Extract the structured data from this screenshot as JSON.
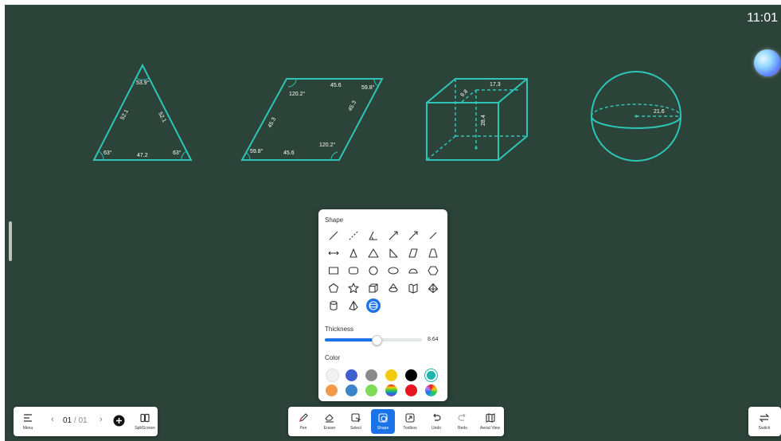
{
  "status": {
    "time": "11:01"
  },
  "figures": {
    "triangle": {
      "angle_top": "53.9°",
      "side_left": "52.1",
      "side_right": "52.1",
      "angle_left": "63°",
      "base": "47.2",
      "angle_right": "63°"
    },
    "parallelogram": {
      "angle_top_left": "120.2°",
      "top_side": "45.6",
      "angle_top_right": "59.8°",
      "left_side": "45.3",
      "right_side": "45.3",
      "angle_bottom_right": "120.2°",
      "angle_bottom_left": "59.8°",
      "bottom_side": "45.6"
    },
    "cube": {
      "depth": "9.8",
      "width": "17.3",
      "height": "28.4"
    },
    "sphere": {
      "radius": "21.6"
    }
  },
  "shape_panel": {
    "title": "Shape",
    "shapes": [
      "line-icon",
      "dashed-line-icon",
      "angle-icon",
      "arrow-icon",
      "double-arrow-icon",
      "pen-line-icon",
      "double-headed-arrow-icon",
      "isosceles-triangle-icon",
      "triangle-icon",
      "right-triangle-icon",
      "parallelogram-icon",
      "trapezoid-icon",
      "rectangle-icon",
      "rounded-rectangle-icon",
      "circle-icon",
      "ellipse-icon",
      "semicircle-icon",
      "hexagon-icon",
      "pentagon-icon",
      "star-icon",
      "cube-icon",
      "cone-icon",
      "prism-icon",
      "pyramid-icon",
      "cylinder-icon",
      "tetrahedron-icon",
      "sphere-icon"
    ],
    "selected_shape": "sphere-icon",
    "thickness_label": "Thickness",
    "thickness_value": "8.64",
    "thickness_fraction": 0.53,
    "color_label": "Color",
    "colors": [
      "#f2f2f2",
      "#3f5fd0",
      "#8a8a8a",
      "#f2cc0c",
      "#000000",
      "#1fb5b0",
      "#f39a4a",
      "#3a86c8",
      "#7ddb58",
      "rainbow",
      "#e8141e",
      "multicolor"
    ],
    "selected_color": "#1fb5b0",
    "stroke_color": "#2ec4b6"
  },
  "toolbar": {
    "menu_label": "Menu",
    "page_current": "01",
    "page_total": "01",
    "splitscreen_label": "SplitScreen",
    "pen_label": "Pen",
    "eraser_label": "Eraser",
    "select_label": "Select",
    "shape_label": "Shape",
    "toolbox_label": "Toolbox",
    "undo_label": "Undo",
    "redo_label": "Redo",
    "aerial_view_label": "Aerial View",
    "switch_label": "Switch",
    "accent_color": "#1a73e8"
  }
}
